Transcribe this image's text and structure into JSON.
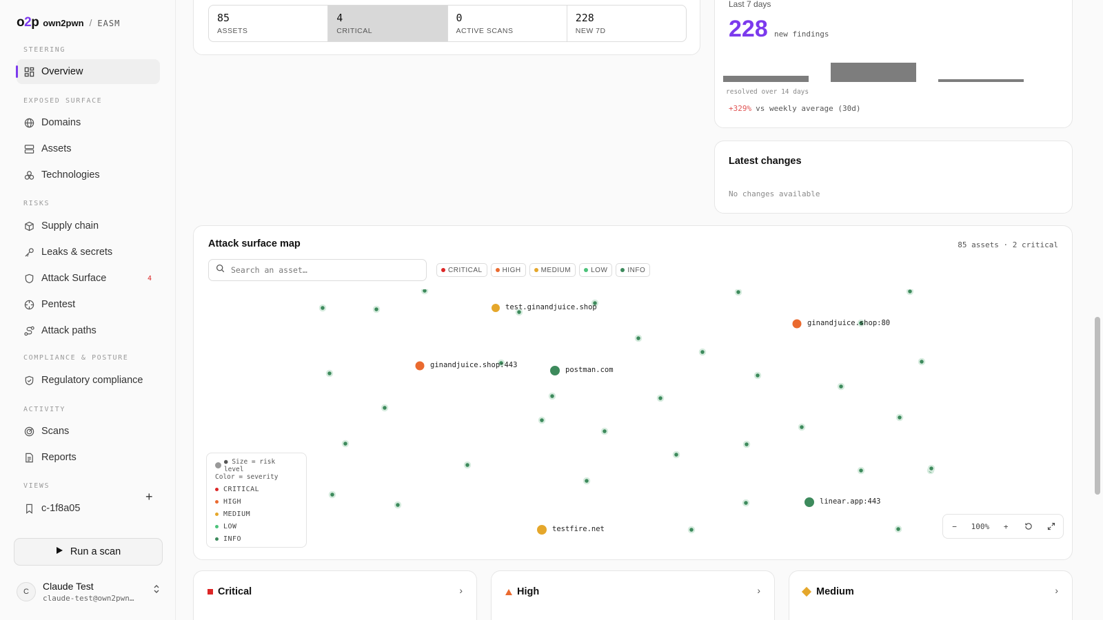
{
  "brand": {
    "logo_o": "o",
    "logo_2": "2",
    "logo_p": "p",
    "org": "own2pwn",
    "separator": "/",
    "product": "EASM"
  },
  "sidebar": {
    "sections": {
      "steering": "STEERING",
      "exposed_surface": "EXPOSED SURFACE",
      "risks": "RISKS",
      "compliance": "COMPLIANCE & POSTURE",
      "activity": "ACTIVITY",
      "views": "VIEWS"
    },
    "items": {
      "overview": "Overview",
      "domains": "Domains",
      "assets": "Assets",
      "technologies": "Technologies",
      "supply_chain": "Supply chain",
      "leaks": "Leaks & secrets",
      "attack_surface": "Attack Surface",
      "attack_surface_badge": "4",
      "pentest": "Pentest",
      "attack_paths": "Attack paths",
      "regulatory": "Regulatory compliance",
      "scans": "Scans",
      "reports": "Reports",
      "view_1": "c-1f8a05"
    },
    "add_view_icon": "plus-icon",
    "run_scan": "Run a scan",
    "user": {
      "initial": "C",
      "name": "Claude Test",
      "email": "claude-test@own2pwn…"
    }
  },
  "stats": [
    {
      "value": "85",
      "label": "ASSETS"
    },
    {
      "value": "4",
      "label": "CRITICAL"
    },
    {
      "value": "0",
      "label": "ACTIVE SCANS"
    },
    {
      "value": "228",
      "label": "NEW 7D"
    }
  ],
  "trend": {
    "period": "Last 7 days",
    "count": "228",
    "count_label": "new findings",
    "bars": [
      0.33,
      1.0,
      0.15
    ],
    "resolved": "resolved over 14 days",
    "delta": "+329%",
    "delta_label": "vs weekly average (30d)",
    "bar_color": "#7d7d7d"
  },
  "changes": {
    "title": "Latest changes",
    "empty": "No changes available"
  },
  "map": {
    "title": "Attack surface map",
    "summary": "85 assets · 2 critical",
    "search_placeholder": "Search an asset…",
    "chips": [
      {
        "label": "CRITICAL",
        "color": "#dc2626"
      },
      {
        "label": "HIGH",
        "color": "#ea6a2f"
      },
      {
        "label": "MEDIUM",
        "color": "#e5a72b"
      },
      {
        "label": "LOW",
        "color": "#4cc27a"
      },
      {
        "label": "INFO",
        "color": "#3d8a5c"
      }
    ],
    "nodes": [
      {
        "label": "test.ginandjuice.shop",
        "severity": "MEDIUM"
      },
      {
        "label": "ginandjuice.shop:80",
        "severity": "HIGH"
      },
      {
        "label": "ginandjuice.shop:443",
        "severity": "HIGH"
      },
      {
        "label": "postman.com",
        "severity": "INFO"
      },
      {
        "label": "linear.app:443",
        "severity": "INFO"
      },
      {
        "label": "testfire.net",
        "severity": "MEDIUM"
      }
    ],
    "legend": {
      "size_hint": "● Size = risk level",
      "color_hint": "Color = severity",
      "items": [
        "CRITICAL",
        "HIGH",
        "MEDIUM",
        "LOW",
        "INFO"
      ]
    },
    "zoom": "100%"
  },
  "severity_cards": [
    {
      "title": "Critical",
      "icon": "square-icon",
      "color": "#dc2626"
    },
    {
      "title": "High",
      "icon": "triangle-icon",
      "color": "#ea6a2f"
    },
    {
      "title": "Medium",
      "icon": "diamond-icon",
      "color": "#e5a72b"
    }
  ]
}
